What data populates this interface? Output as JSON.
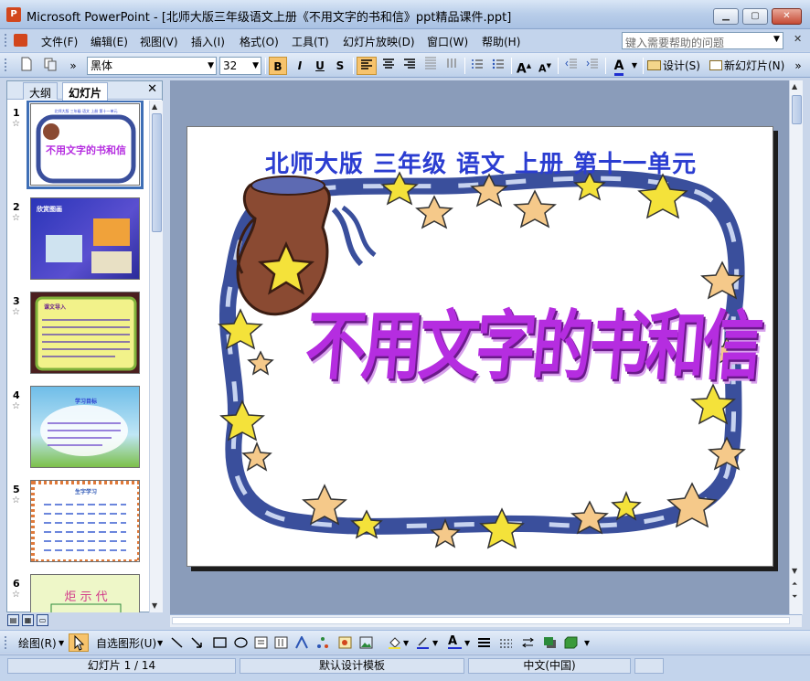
{
  "window": {
    "title": "Microsoft PowerPoint - [北师大版三年级语文上册《不用文字的书和信》ppt精品课件.ppt]",
    "app_icon_label": "P",
    "minimize": "▁",
    "maximize": "▢",
    "close": "✕"
  },
  "menu": {
    "items": [
      "文件(F)",
      "编辑(E)",
      "视图(V)",
      "插入(I)",
      "格式(O)",
      "工具(T)",
      "幻灯片放映(D)",
      "窗口(W)",
      "帮助(H)"
    ],
    "help_placeholder": "键入需要帮助的问题",
    "close_glyph": "✕"
  },
  "toolbar": {
    "font_name": "黑体",
    "font_size": "32",
    "bold": "B",
    "italic": "I",
    "underline": "U",
    "shadow": "S",
    "grow_font": "A",
    "shrink_font": "A",
    "font_color": "A",
    "design_label": "设计(S)",
    "new_slide_label": "新幻灯片(N)"
  },
  "left_pane": {
    "tab_outline": "大纲",
    "tab_slides": "幻灯片",
    "close": "✕",
    "slides": [
      {
        "num": "1",
        "mini_heading": "北师大版 三年级 语文 上册 第十一单元",
        "mini_title": "不用文字的书和信"
      },
      {
        "num": "2",
        "mini_heading": "欣赏图画"
      },
      {
        "num": "3",
        "mini_heading": "课文导入"
      },
      {
        "num": "4",
        "mini_heading": "学习目标"
      },
      {
        "num": "5",
        "mini_heading": "生字学习"
      },
      {
        "num": "6",
        "mini_heading": "炬  示  代"
      }
    ]
  },
  "slide": {
    "heading": "北师大版  三年级  语文  上册  第十一单元",
    "main_title": "不用文字的书和信"
  },
  "drawbar": {
    "draw_label": "绘图(R)",
    "autoshapes_label": "自选图形(U)"
  },
  "status": {
    "slide_position": "幻灯片 1 / 14",
    "template": "默认设计模板",
    "language": "中文(中国)"
  },
  "colors": {
    "heading": "#2b3dd1",
    "title": "#b52de0",
    "frame_blue": "#3a4f9c",
    "star_yellow": "#f4e23a",
    "star_peach": "#f5c98a",
    "jug_brown": "#8a4a32"
  }
}
